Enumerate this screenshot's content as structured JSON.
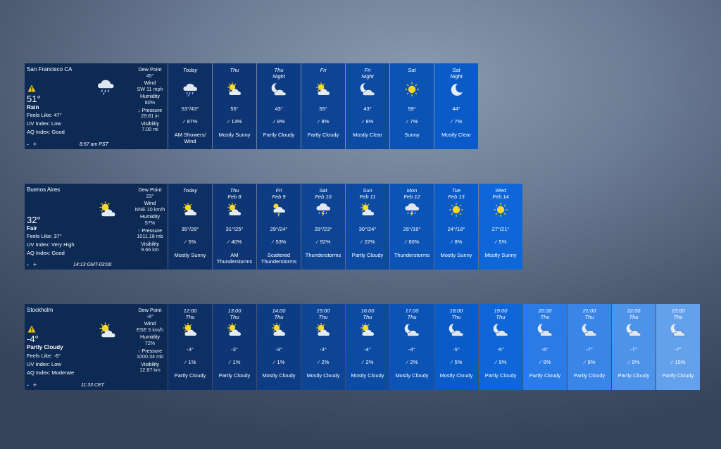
{
  "widgets": [
    {
      "city": "San Francisco CA",
      "temp": "51°",
      "condition": "Rain",
      "feels_like": "Feels Like: 47°",
      "uv_index": "UV Index: Low",
      "aq_index": "AQ Index: Good",
      "zoom_minus": "-",
      "zoom_plus": "+",
      "time": "8:57 am  PST",
      "current_icon": "rain-cloud-icon",
      "dew_point_label": "Dew Point",
      "dew_point": "45°",
      "wind_label": "Wind",
      "wind": "SW 11 mph",
      "humidity_label": "Humidity",
      "humidity": "80%",
      "pressure_label": "↓ Pressure",
      "pressure": "29.81 in",
      "visibility_label": "Visibility",
      "visibility": "7.00 mi",
      "columns": [
        {
          "line1": "Today",
          "line2": "",
          "icon": "rain-cloud-icon",
          "temp": "53°/43°",
          "rain": "87%",
          "desc": "AM Showers/ Wind",
          "bg": "#0d2f63"
        },
        {
          "line1": "Thu",
          "line2": "",
          "icon": "sun-cloud-icon",
          "temp": "55°",
          "rain": "13%",
          "desc": "Mostly Sunny",
          "bg": "#0e3675"
        },
        {
          "line1": "Thu",
          "line2": "Night",
          "icon": "moon-cloud-icon",
          "temp": "43°",
          "rain": "8%",
          "desc": "Partly Cloudy",
          "bg": "#0e3c84"
        },
        {
          "line1": "Fri",
          "line2": "",
          "icon": "sun-cloud-icon",
          "temp": "55°",
          "rain": "8%",
          "desc": "Partly Cloudy",
          "bg": "#0d4494"
        },
        {
          "line1": "Fri",
          "line2": "Night",
          "icon": "moon-cloud-icon",
          "temp": "43°",
          "rain": "8%",
          "desc": "Mostly Clear",
          "bg": "#0c4ba3"
        },
        {
          "line1": "Sat",
          "line2": "",
          "icon": "sun-icon",
          "temp": "59°",
          "rain": "7%",
          "desc": "Sunny",
          "bg": "#0b53b5"
        },
        {
          "line1": "Sat",
          "line2": "Night",
          "icon": "moon-icon",
          "temp": "44°",
          "rain": "7%",
          "desc": "Mostly Clear",
          "bg": "#0a5bc7"
        }
      ]
    },
    {
      "city": "Buenos Aires",
      "temp": "32°",
      "condition": "Fair",
      "feels_like": "Feels Like: 37°",
      "uv_index": "UV Index: Very High",
      "aq_index": "AQ Index: Good",
      "zoom_minus": "-",
      "zoom_plus": "+",
      "time": "14:13  GMT-03:00",
      "current_icon": "sun-cloud-icon",
      "dew_point_label": "Dew Point",
      "dew_point": "23°",
      "wind_label": "Wind",
      "wind": "NNE 10 km/h",
      "humidity_label": "Humidity",
      "humidity": "57%",
      "pressure_label": "↑ Pressure",
      "pressure": "1011.18 mb",
      "visibility_label": "Visibility",
      "visibility": "9.66 km",
      "columns": [
        {
          "line1": "Today",
          "line2": "",
          "icon": "sun-cloud-icon",
          "temp": "35°/28°",
          "rain": "5%",
          "desc": "Mostly Sunny",
          "bg": "#0d2f63"
        },
        {
          "line1": "Thu",
          "line2": "Feb 8",
          "icon": "sun-cloud-icon",
          "temp": "31°/25°",
          "rain": "40%",
          "desc": "AM Thunderstorms",
          "bg": "#0e3675"
        },
        {
          "line1": "Fri",
          "line2": "Feb 9",
          "icon": "sun-storm-icon",
          "temp": "29°/24°",
          "rain": "53%",
          "desc": "Scattered Thunderstorms",
          "bg": "#0e3c84"
        },
        {
          "line1": "Sat",
          "line2": "Feb 10",
          "icon": "storm-cloud-icon",
          "temp": "28°/23°",
          "rain": "92%",
          "desc": "Thunderstorms",
          "bg": "#0d4494"
        },
        {
          "line1": "Sun",
          "line2": "Feb 11",
          "icon": "sun-cloud-icon",
          "temp": "30°/24°",
          "rain": "22%",
          "desc": "Partly Cloudy",
          "bg": "#0c4ba3"
        },
        {
          "line1": "Mon",
          "line2": "Feb 12",
          "icon": "storm-cloud-icon",
          "temp": "26°/16°",
          "rain": "80%",
          "desc": "Thunderstorms",
          "bg": "#0b53b5"
        },
        {
          "line1": "Tue",
          "line2": "Feb 13",
          "icon": "sun-icon",
          "temp": "24°/18°",
          "rain": "8%",
          "desc": "Mostly Sunny",
          "bg": "#0a5bc7"
        },
        {
          "line1": "Wed",
          "line2": "Feb 14",
          "icon": "sun-icon",
          "temp": "27°/21°",
          "rain": "5%",
          "desc": "Mostly Sunny",
          "bg": "#0f66d9"
        }
      ]
    },
    {
      "city": "Stockholm",
      "temp": "-4°",
      "condition": "Partly Cloudy",
      "feels_like": "Feels Like: -6°",
      "uv_index": "UV Index: Low",
      "aq_index": "AQ Index: Moderate",
      "zoom_minus": "-",
      "zoom_plus": "+",
      "time": "11:33  CET",
      "current_icon": "sun-cloud-icon",
      "dew_point_label": "Dew Point",
      "dew_point": "-8°",
      "wind_label": "Wind",
      "wind": "ESE 5 km/h",
      "humidity_label": "Humidity",
      "humidity": "72%",
      "pressure_label": "↑ Pressure",
      "pressure": "1000.34 mb",
      "visibility_label": "Visibility",
      "visibility": "12.87 km",
      "columns": [
        {
          "line1": "12:00",
          "line2": "Thu",
          "icon": "sun-cloud-icon",
          "temp": "-3°",
          "rain": "1%",
          "desc": "Partly Cloudy",
          "bg": "#0d2f63"
        },
        {
          "line1": "13:00",
          "line2": "Thu",
          "icon": "sun-cloud-icon",
          "temp": "-3°",
          "rain": "1%",
          "desc": "Partly Cloudy",
          "bg": "#0e3675"
        },
        {
          "line1": "14:00",
          "line2": "Thu",
          "icon": "sun-cloud-icon",
          "temp": "-3°",
          "rain": "1%",
          "desc": "Mostly Cloudy",
          "bg": "#0e3c84"
        },
        {
          "line1": "15:00",
          "line2": "Thu",
          "icon": "sun-cloud-icon",
          "temp": "-3°",
          "rain": "2%",
          "desc": "Mostly Cloudy",
          "bg": "#0d4494"
        },
        {
          "line1": "16:00",
          "line2": "Thu",
          "icon": "sun-cloud-icon",
          "temp": "-4°",
          "rain": "2%",
          "desc": "Mostly Cloudy",
          "bg": "#0c4ba3"
        },
        {
          "line1": "17:00",
          "line2": "Thu",
          "icon": "moon-cloud-icon",
          "temp": "-4°",
          "rain": "2%",
          "desc": "Mostly Cloudy",
          "bg": "#0b53b5"
        },
        {
          "line1": "18:00",
          "line2": "Thu",
          "icon": "moon-cloud-icon",
          "temp": "-5°",
          "rain": "5%",
          "desc": "Mostly Cloudy",
          "bg": "#0a5bc7"
        },
        {
          "line1": "19:00",
          "line2": "Thu",
          "icon": "moon-cloud-icon",
          "temp": "-5°",
          "rain": "9%",
          "desc": "Partly Cloudy",
          "bg": "#0f66d9"
        },
        {
          "line1": "20:00",
          "line2": "Thu",
          "icon": "moon-cloud-icon",
          "temp": "-6°",
          "rain": "9%",
          "desc": "Partly Cloudy",
          "bg": "#2a7be6"
        },
        {
          "line1": "21:00",
          "line2": "Thu",
          "icon": "moon-cloud-icon",
          "temp": "-7°",
          "rain": "9%",
          "desc": "Partly Cloudy",
          "bg": "#3a86e8"
        },
        {
          "line1": "22:00",
          "line2": "Thu",
          "icon": "moon-cloud-icon",
          "temp": "-7°",
          "rain": "9%",
          "desc": "Partly Cloudy",
          "bg": "#4e93ea"
        },
        {
          "line1": "23:00",
          "line2": "Thu",
          "icon": "moon-cloud-icon",
          "temp": "-7°",
          "rain": "15%",
          "desc": "Partly Cloudy",
          "bg": "#64a1ec"
        }
      ]
    }
  ]
}
